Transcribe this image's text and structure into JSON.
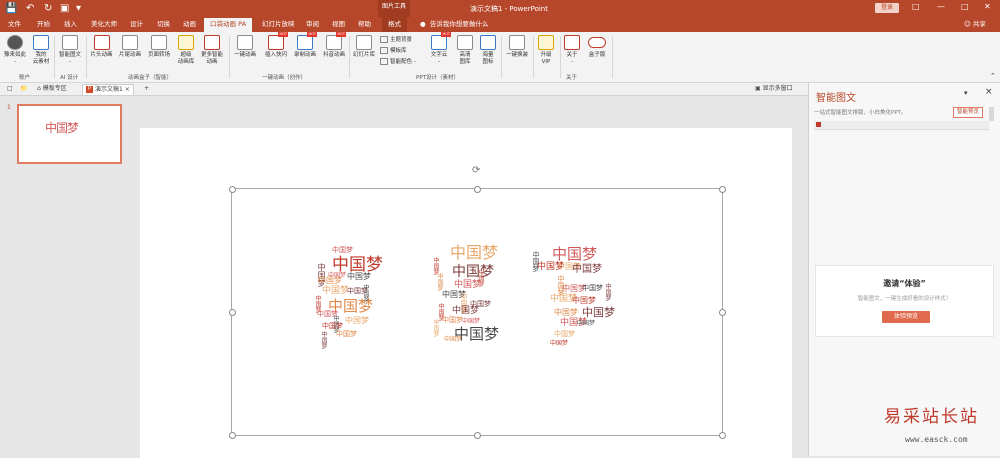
{
  "app": {
    "title": "演示文稿1 - PowerPoint",
    "context_tab_header": "图片工具",
    "login_label": "登录",
    "share_label": "共享",
    "tellme_placeholder": "告诉我你想要做什么",
    "quick_access_icons": [
      "save-icon",
      "undo-icon",
      "redo-icon",
      "start-slideshow-icon",
      "customize-icon"
    ]
  },
  "tabs": [
    {
      "label": "文件",
      "state": "normal"
    },
    {
      "label": "开始",
      "state": "normal"
    },
    {
      "label": "插入",
      "state": "normal"
    },
    {
      "label": "美化大师",
      "state": "normal"
    },
    {
      "label": "设计",
      "state": "normal"
    },
    {
      "label": "切换",
      "state": "normal"
    },
    {
      "label": "动画",
      "state": "normal"
    },
    {
      "label": "口袋动画 PA",
      "state": "active"
    },
    {
      "label": "幻灯片放映",
      "state": "normal"
    },
    {
      "label": "审阅",
      "state": "normal"
    },
    {
      "label": "视图",
      "state": "normal"
    },
    {
      "label": "帮助",
      "state": "normal"
    },
    {
      "label": "格式",
      "state": "context"
    }
  ],
  "ribbon": {
    "buttons": [
      {
        "label": "豫来如此",
        "label2": "",
        "icon": "avatar-icon"
      },
      {
        "label": "我的",
        "label2": "云素材",
        "icon": "cloud-icon"
      },
      {
        "label": "智能图文",
        "label2": "",
        "icon": "smart-graphic-icon"
      },
      {
        "label": "片头动画",
        "label2": "",
        "icon": "intro-animation-icon"
      },
      {
        "label": "片尾动画",
        "label2": "",
        "icon": "outro-animation-icon"
      },
      {
        "label": "页面转场",
        "label2": "",
        "icon": "transition-icon"
      },
      {
        "label": "超级",
        "label2": "动画库",
        "icon": "super-library-icon"
      },
      {
        "label": "更多智能",
        "label2": "动画",
        "icon": "more-smart-icon"
      },
      {
        "label": "一键动画",
        "label2": "",
        "icon": "magic-wand-icon"
      },
      {
        "label": "插入快闪",
        "label2": "",
        "icon": "flash-insert-icon",
        "hot": "HOT"
      },
      {
        "label": "录制动画",
        "label2": "",
        "icon": "record-icon",
        "hot": "HOT"
      },
      {
        "label": "抖音动画",
        "label2": "",
        "icon": "douyin-icon",
        "hot": "HOT"
      },
      {
        "label": "幻灯片库",
        "label2": "",
        "icon": "slide-library-icon"
      },
      {
        "label": "文字云",
        "label2": "",
        "icon": "word-cloud-icon",
        "hot": "HOT"
      },
      {
        "label": "高清",
        "label2": "图库",
        "icon": "hd-gallery-icon"
      },
      {
        "label": "海量",
        "label2": "图标",
        "icon": "icon-library-icon"
      },
      {
        "label": "一键换装",
        "label2": "",
        "icon": "reskin-icon"
      },
      {
        "label": "升级",
        "label2": "VIP",
        "icon": "crown-icon"
      },
      {
        "label": "关于",
        "label2": "",
        "icon": "about-icon"
      },
      {
        "label": "盒子版",
        "label2": "",
        "icon": "toggle-icon"
      }
    ],
    "small_items": [
      {
        "label": "主题背景"
      },
      {
        "label": "模板库"
      },
      {
        "label": "智能配色 -"
      }
    ],
    "groups": [
      {
        "label": "账户"
      },
      {
        "label": "AI 设计"
      },
      {
        "label": "动画盒子（智能）"
      },
      {
        "label": "一键动画（创作）"
      },
      {
        "label": "PPT设计（素材）"
      },
      {
        "label": "关于"
      }
    ]
  },
  "doc_tabs": [
    {
      "label": "模板专区"
    },
    {
      "label": "演示文稿1"
    }
  ],
  "doc_tab_add": "+",
  "show_multi_window": "显示多窗口",
  "thumbnails": [
    {
      "number": "1"
    }
  ],
  "word_cloud": {
    "word": "中国梦",
    "letters": "PPT",
    "colors": [
      "#c0392b",
      "#7b3b3b",
      "#e08a4a",
      "#d35a5a",
      "#4a4a4a",
      "#e8a86b"
    ]
  },
  "right_panel": {
    "title": "智能图文",
    "subtitle": "一站式智能图文排版，小白美化PPT。",
    "preview_button": "智能预览",
    "invite_title": "邀请“体验”",
    "invite_subtitle": "智能图文，一键生成好看的设计样式！",
    "invite_button": "体验预览"
  },
  "watermark": {
    "text": "易采站长站",
    "url": "www.easck.com"
  }
}
